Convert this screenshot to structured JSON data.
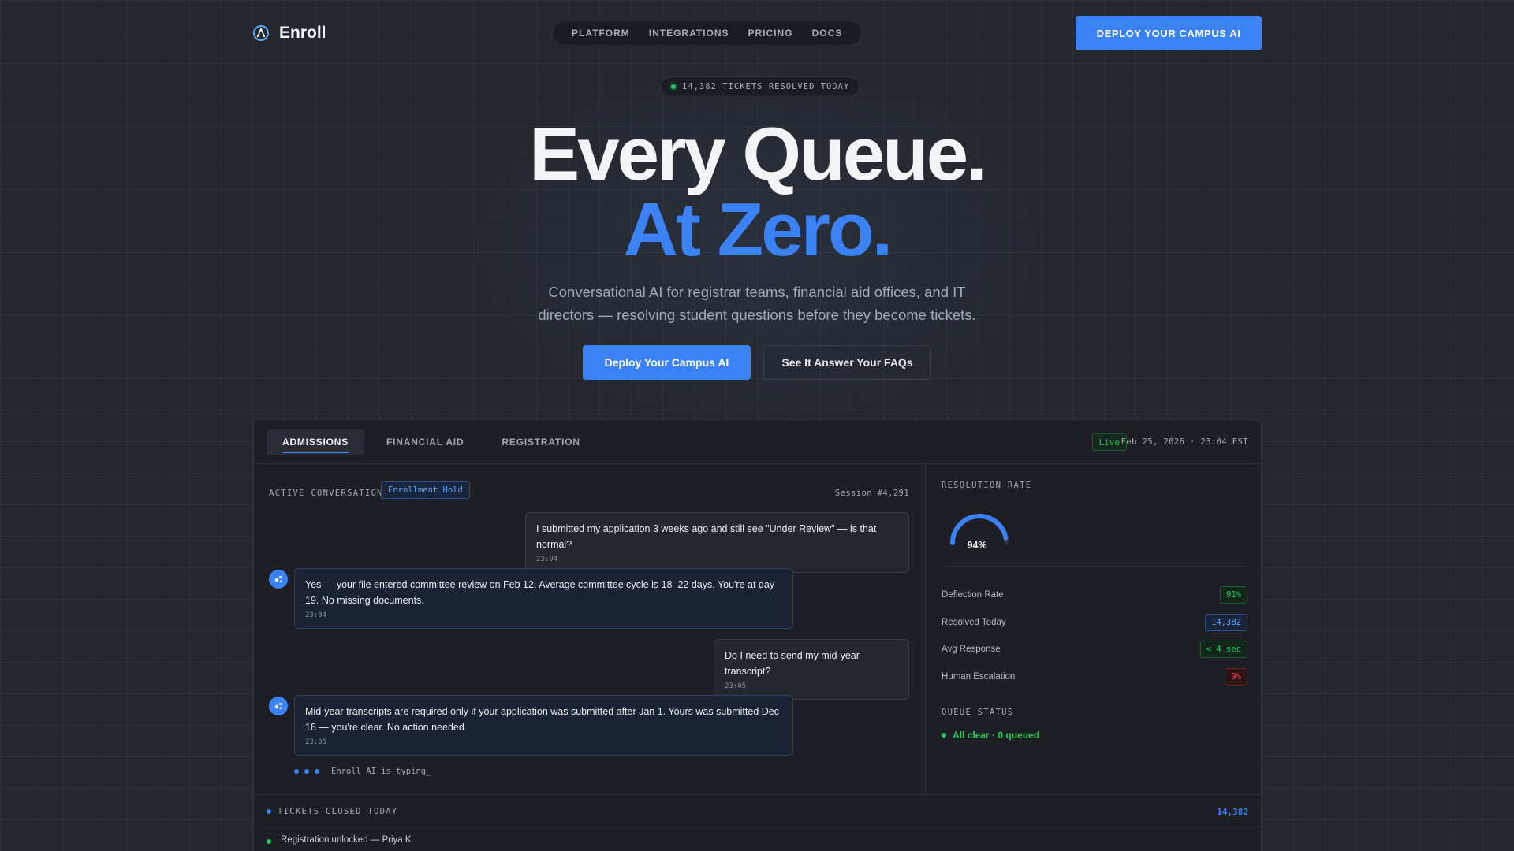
{
  "brand": {
    "name": "Enroll"
  },
  "nav": {
    "links": [
      "PLATFORM",
      "INTEGRATIONS",
      "PRICING",
      "DOCS"
    ],
    "cta": "DEPLOY YOUR CAMPUS AI"
  },
  "hero": {
    "badge": "14,382 TICKETS RESOLVED TODAY",
    "title_line1": "Every Queue.",
    "title_line2": "At Zero.",
    "subtitle": "Conversational AI for registrar teams, financial aid offices, and IT directors — resolving student questions before they become tickets.",
    "primary_button": "Deploy Your Campus AI",
    "secondary_button": "See It Answer Your FAQs"
  },
  "dashboard": {
    "tabs": [
      {
        "label": "ADMISSIONS",
        "active": true
      },
      {
        "label": "FINANCIAL AID",
        "active": false
      },
      {
        "label": "REGISTRATION",
        "active": false
      }
    ],
    "live_label": "Live",
    "timestamp": "Feb 25, 2026 · 23:04 EST",
    "chat": {
      "header_label": "ACTIVE CONVERSATION",
      "tag": "Enrollment Hold",
      "session": "Session #4,291",
      "messages": [
        {
          "role": "user",
          "text": "I submitted my application 3 weeks ago and still see \"Under Review\" — is that normal?",
          "time": "23:04"
        },
        {
          "role": "ai",
          "text": "Yes — your file entered committee review on Feb 12. Average committee cycle is 18–22 days. You're at day 19. No missing documents.",
          "time": "23:04"
        },
        {
          "role": "user",
          "text": "Do I need to send my mid-year transcript?",
          "time": "23:05"
        },
        {
          "role": "ai",
          "text": "Mid-year transcripts are required only if your application was submitted after Jan 1. Yours was submitted Dec 18 — you're clear. No action needed.",
          "time": "23:05"
        }
      ],
      "typing": "Enroll AI is typing_"
    },
    "side": {
      "resolution_label": "RESOLUTION RATE",
      "resolution_value": "94%",
      "resolution_fraction": 0.94,
      "metrics": [
        {
          "label": "Deflection Rate",
          "value": "91%",
          "tone": "green"
        },
        {
          "label": "Resolved Today",
          "value": "14,382",
          "tone": "blue"
        },
        {
          "label": "Avg Response",
          "value": "< 4 sec",
          "tone": "green"
        },
        {
          "label": "Human Escalation",
          "value": "9%",
          "tone": "red"
        }
      ],
      "queue_label": "QUEUE STATUS",
      "queue_status": "All clear · 0 queued"
    },
    "ticker": {
      "label": "TICKETS CLOSED TODAY",
      "count": "14,382",
      "feed_item": "Registration unlocked — Priya K."
    }
  },
  "colors": {
    "accent": "#3b82f6",
    "success": "#22c55e",
    "danger": "#ef4444",
    "background": "#24272d"
  }
}
